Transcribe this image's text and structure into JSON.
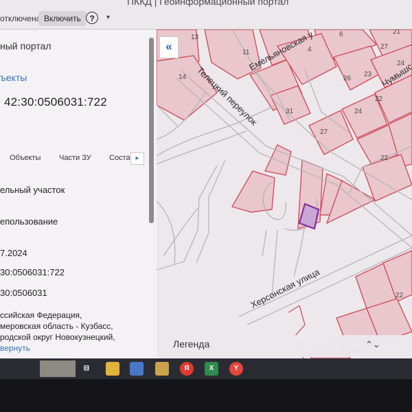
{
  "browser": {
    "window_title": "ПККД | Геоинформационный портал",
    "notice_text": "отключена",
    "enable_button": "Включить",
    "help_icon": "help-icon"
  },
  "panel": {
    "portal_title": "ный портал",
    "objects_link": "ъекты",
    "cadastral_number": "42:30:0506031:722",
    "tabs": [
      "Объекты",
      "Части ЗУ",
      "Соста"
    ],
    "fields": [
      "ельный участок",
      "епользование",
      "7.2024",
      "30:0506031:722",
      "30:0506031",
      "ссийская Федерация,",
      "меровская область - Кузбасс,",
      "родской округ Новокузнецкий,"
    ],
    "collapse_link": "вернуть"
  },
  "map": {
    "collapse_icon": "«",
    "streets": {
      "teletsky": "Телецкий переулок",
      "emelyanovskaya": "Емельяновская у",
      "chumysh": "Чумышс",
      "khersonskaya": "Херсонская улица"
    },
    "lot_numbers": [
      "13",
      "11",
      "6",
      "4",
      "27",
      "21",
      "14",
      "24",
      "26",
      "23",
      "22",
      "31",
      "24",
      "27",
      "22",
      "22"
    ],
    "legend_label": "Легенда",
    "legend_toggle": "⌃⌄"
  },
  "taskbar": {
    "icons": [
      {
        "name": "task-view-icon",
        "glyph": "⊟",
        "color": "#2b2c33"
      },
      {
        "name": "file-explorer-icon",
        "glyph": "",
        "color": "#e2b33a"
      },
      {
        "name": "notes-icon",
        "glyph": "",
        "color": "#4a78c8"
      },
      {
        "name": "folder-icon",
        "glyph": "",
        "color": "#c9a24a"
      },
      {
        "name": "yandex-icon",
        "glyph": "Я",
        "color": "#e23a2e"
      },
      {
        "name": "excel-icon",
        "glyph": "X",
        "color": "#2f8a4b"
      },
      {
        "name": "yandex-browser-icon",
        "glyph": "Y",
        "color": "#e8453c"
      }
    ]
  }
}
